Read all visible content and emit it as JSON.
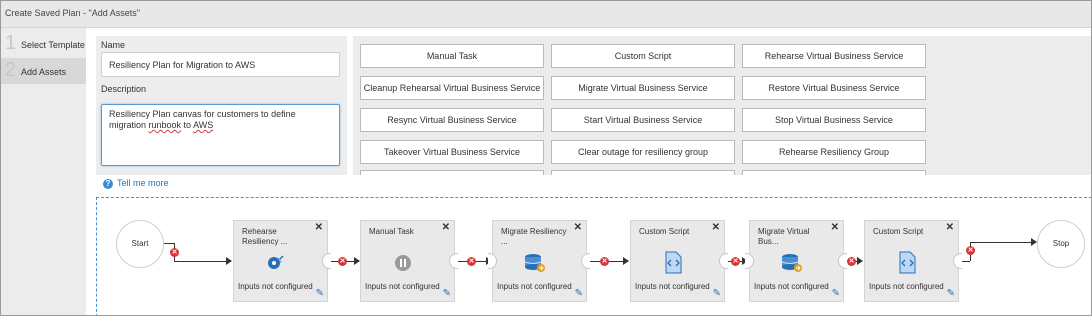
{
  "window": {
    "title": "Create Saved Plan - \"Add Assets\""
  },
  "steps": [
    {
      "number": "1",
      "label": "Select Template"
    },
    {
      "number": "2",
      "label": "Add Assets"
    }
  ],
  "form": {
    "name_label": "Name",
    "name_value": "Resiliency Plan for Migration to AWS",
    "description_label": "Description",
    "description_part1": "Resiliency Plan canvas for customers to define migration ",
    "description_part2": "runbook",
    "description_part3": " to ",
    "description_part4": "AWS"
  },
  "palette": {
    "items": [
      "Manual Task",
      "Custom Script",
      "Rehearse Virtual Business Service",
      "Cleanup Rehearsal Virtual Business Service",
      "Migrate Virtual Business Service",
      "Restore Virtual Business Service",
      "Resync Virtual Business Service",
      "Start Virtual Business Service",
      "Stop Virtual Business Service",
      "Takeover Virtual Business Service",
      "Clear outage for resiliency group",
      "Rehearse Resiliency Group"
    ]
  },
  "tell_me_more": "Tell me more",
  "canvas": {
    "start_label": "Start",
    "stop_label": "Stop",
    "nodes": [
      {
        "title": "Rehearse Resiliency ...",
        "status": "Inputs not configured",
        "icon": "rehearse-icon"
      },
      {
        "title": "Manual Task",
        "status": "Inputs not configured",
        "icon": "pause-icon"
      },
      {
        "title": "Migrate Resiliency ...",
        "status": "Inputs not configured",
        "icon": "database-migrate-icon"
      },
      {
        "title": "Custom Script",
        "status": "Inputs not configured",
        "icon": "script-file-icon"
      },
      {
        "title": "Migrate Virtual Bus...",
        "status": "Inputs not configured",
        "icon": "database-migrate-icon"
      },
      {
        "title": "Custom Script",
        "status": "Inputs not configured",
        "icon": "script-file-icon"
      }
    ]
  },
  "colors": {
    "accent": "#2a6fb5",
    "error": "#d9343a",
    "focus": "#5b9bd5"
  }
}
